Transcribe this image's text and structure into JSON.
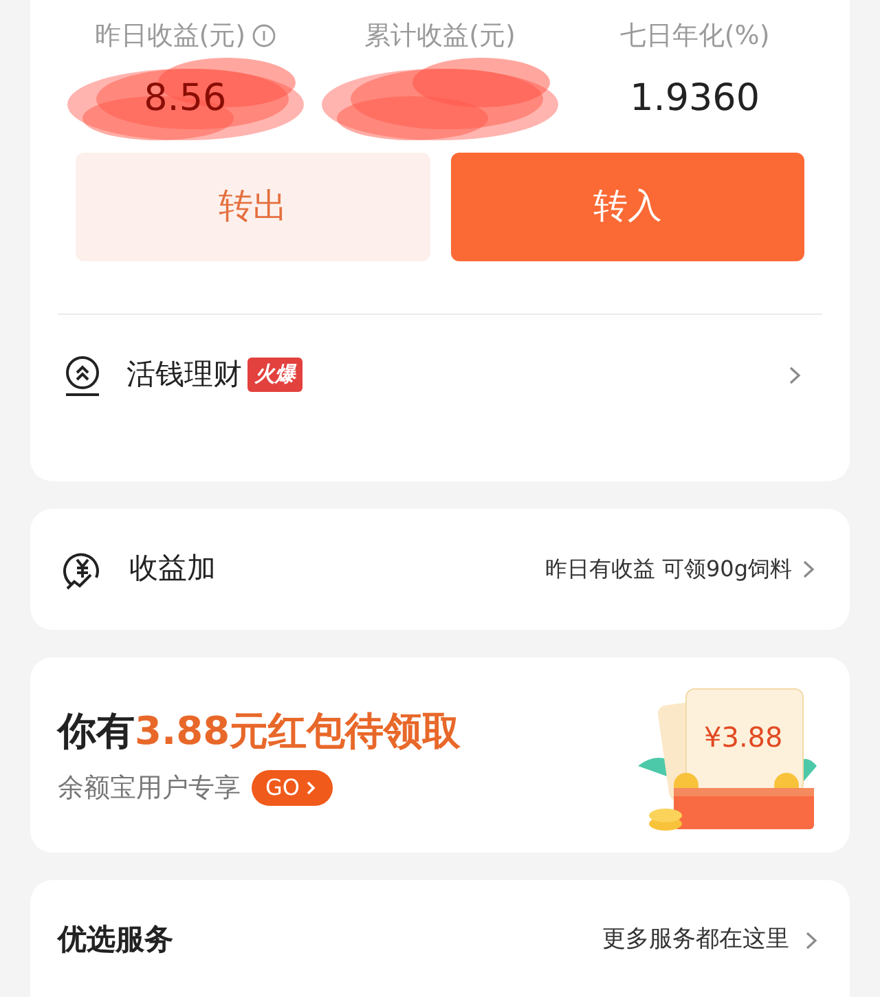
{
  "stats": [
    {
      "label": "昨日收益(元)",
      "info": true,
      "value": "8.56",
      "redacted": true
    },
    {
      "label": "累计收益(元)",
      "info": false,
      "redacted": true
    },
    {
      "label": "七日年化(%)",
      "info": false,
      "value": "1.9360",
      "redacted": false
    }
  ],
  "actions": [
    {
      "label": "转出",
      "primary": false
    },
    {
      "label": "转入",
      "primary": true
    }
  ],
  "product_row": {
    "title": "活钱理财",
    "badge": "火爆"
  },
  "bonus_row": {
    "title": "收益加",
    "detail": "昨日有收益 可领90g饲料"
  },
  "promo": {
    "title_lead": "你有",
    "title_highlight": "3.88元红包待领取",
    "subtitle": "余额宝用户专享",
    "go_label": "GO",
    "coupon_amount": "¥3.88"
  },
  "services": {
    "title": "优选服务",
    "link": "更多服务都在这里"
  }
}
